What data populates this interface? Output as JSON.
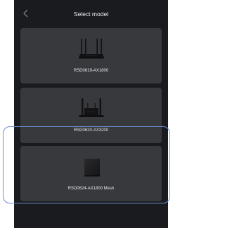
{
  "header": {
    "title": "Select model",
    "back_icon": "chevron-left-icon"
  },
  "models": [
    {
      "label": "RSD0619-AX1800",
      "image": "router-four-antenna-icon"
    },
    {
      "label": "RSD0620-AX3200",
      "image": "router-antenna-rear-icon"
    },
    {
      "label": "RSD0624-AX1800 Mesh",
      "image": "mesh-cube-router-icon"
    }
  ],
  "colors": {
    "background": "#1a1b1f",
    "card": "#38393d",
    "text": "#e6e6e6",
    "selection_outline": "#6d8fd6"
  }
}
